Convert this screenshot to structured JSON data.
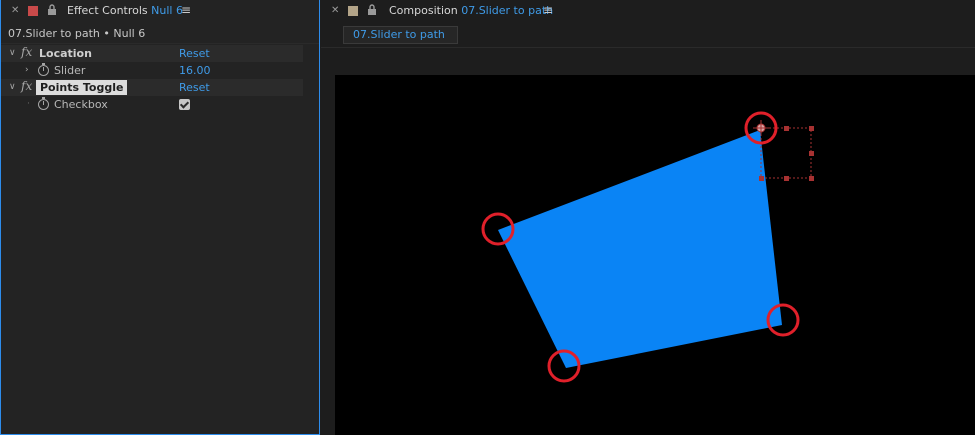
{
  "effect_controls": {
    "title": "Effect Controls",
    "layer": "Null 6",
    "subheader": "07.Slider to path • Null 6",
    "effects": [
      {
        "name": "Location",
        "reset": "Reset",
        "property": {
          "name": "Slider",
          "value": "16.00"
        }
      },
      {
        "name": "Points Toggle",
        "reset": "Reset",
        "property": {
          "name": "Checkbox",
          "checked": true
        }
      }
    ],
    "fx_glyph": "fx"
  },
  "composition": {
    "title": "Composition",
    "comp_name": "07.Slider to path",
    "tab_label": "07.Slider to path"
  },
  "viewer": {
    "shape_color": "#0a84f5",
    "marker_color": "#e0202a",
    "handle_color": "#a83232"
  }
}
